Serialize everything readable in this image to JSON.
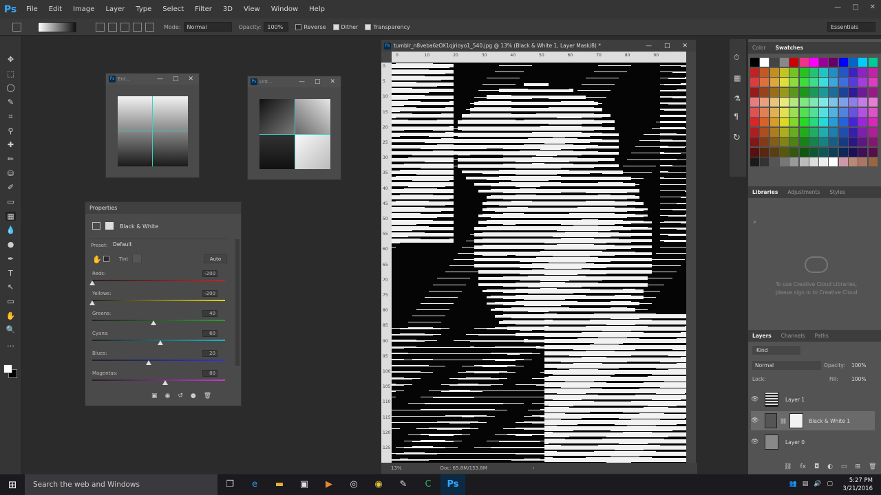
{
  "app": {
    "logo": "Ps",
    "menu": [
      "File",
      "Edit",
      "Image",
      "Layer",
      "Type",
      "Select",
      "Filter",
      "3D",
      "View",
      "Window",
      "Help"
    ],
    "window_controls": [
      "—",
      "□",
      "✕"
    ]
  },
  "options_bar": {
    "mode_label": "Mode:",
    "mode_value": "Normal",
    "opacity_label": "Opacity:",
    "opacity_value": "100%",
    "reverse_label": "Reverse",
    "dither_label": "Dither",
    "transparency_label": "Transparency",
    "workspace": "Essentials"
  },
  "toolbar": {
    "tools": [
      "move-tool",
      "marquee-tool",
      "lasso-tool",
      "quick-select-tool",
      "crop-tool",
      "eyedropper-tool",
      "healing-tool",
      "brush-tool",
      "clone-stamp-tool",
      "history-brush-tool",
      "eraser-tool",
      "gradient-tool",
      "blur-tool",
      "dodge-tool",
      "pen-tool",
      "type-tool",
      "path-select-tool",
      "shape-tool",
      "hand-tool",
      "zoom-tool",
      "more-tools"
    ]
  },
  "float1": {
    "title": "Ent..."
  },
  "float2": {
    "title": "Unt..."
  },
  "properties": {
    "title": "Properties",
    "adjustment": "Black & White",
    "preset_label": "Preset:",
    "preset_value": "Default",
    "tint_label": "Tint",
    "auto_label": "Auto",
    "sliders": [
      {
        "label": "Reds:",
        "value": "-200",
        "fraction": 0.0,
        "track": "linear-gradient(90deg,#222,#d12020)"
      },
      {
        "label": "Yellows:",
        "value": "-200",
        "fraction": 0.0,
        "track": "linear-gradient(90deg,#222,#e2d21a)"
      },
      {
        "label": "Greens:",
        "value": "40",
        "fraction": 0.47,
        "track": "linear-gradient(90deg,#222,#2aa12a)"
      },
      {
        "label": "Cyans:",
        "value": "60",
        "fraction": 0.52,
        "track": "linear-gradient(90deg,#222,#19b7c5)"
      },
      {
        "label": "Blues:",
        "value": "20",
        "fraction": 0.43,
        "track": "linear-gradient(90deg,#222,#2d36d6)"
      },
      {
        "label": "Magentas:",
        "value": "80",
        "fraction": 0.56,
        "track": "linear-gradient(90deg,#222,#c83ad2)"
      }
    ]
  },
  "document": {
    "title": "tumblr_n8veba6zOX1qjrioyo1_540.jpg @ 13% (Black & White 1, Layer Mask/8) *",
    "zoom": "13%",
    "doc_size": "Doc: 65.8M/153.8M",
    "ruler_top": [
      "0",
      "10",
      "20",
      "30",
      "40",
      "50",
      "60",
      "70",
      "80",
      "90"
    ],
    "ruler_left": [
      "0",
      "5",
      "10",
      "15",
      "20",
      "25",
      "30",
      "35",
      "40",
      "45",
      "50",
      "55",
      "60",
      "65",
      "70",
      "75",
      "80",
      "85",
      "90",
      "95",
      "100",
      "105",
      "110",
      "115",
      "120",
      "125"
    ]
  },
  "panels": {
    "color_tabs": [
      "Color",
      "Swatches"
    ],
    "library_tabs": [
      "Libraries",
      "Adjustments",
      "Styles"
    ],
    "library_message": "To use Creative Cloud Libraries, please sign in to Creative Cloud",
    "layers_tabs": [
      "Layers",
      "Channels",
      "Paths"
    ],
    "kind_label": "Kind",
    "blend_mode": "Normal",
    "opacity_label": "Opacity:",
    "opacity_value": "100%",
    "lock_label": "Lock:",
    "fill_label": "Fill:",
    "fill_value": "100%",
    "layers": [
      {
        "name": "Layer 1"
      },
      {
        "name": "Black & White 1"
      },
      {
        "name": "Layer 0"
      }
    ]
  },
  "taskbar": {
    "search_placeholder": "Search the web and Windows",
    "time": "5:27 PM",
    "date": "3/21/2016"
  },
  "colors": {
    "accent": "#31a8ff",
    "panel": "#535353",
    "canvas": "#050505"
  }
}
